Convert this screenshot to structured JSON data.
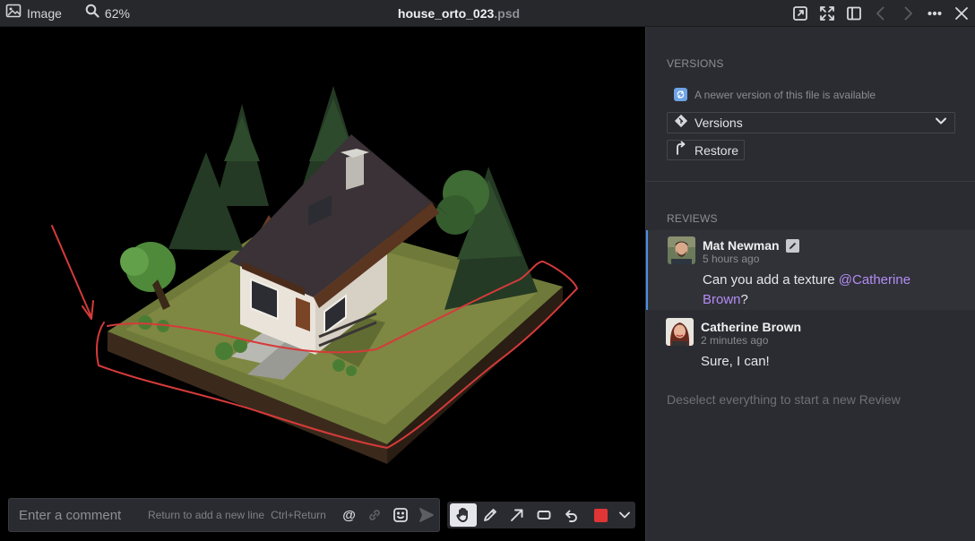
{
  "topbar": {
    "image_label": "Image",
    "zoom": "62%",
    "filename_base": "house_orto_023",
    "filename_ext": ".psd",
    "icons": [
      "image-icon",
      "zoom-icon",
      "open-external-icon",
      "fullscreen-icon",
      "panel-toggle-icon",
      "prev-icon",
      "next-icon",
      "more-icon",
      "close-icon"
    ]
  },
  "comment": {
    "placeholder": "Enter a comment",
    "hint_newline": "Return to add a new line",
    "hint_send": "Ctrl+Return to send",
    "mention_symbol": "@"
  },
  "tools": {
    "items": [
      "hand-tool",
      "pen-tool",
      "arrow-tool",
      "rectangle-tool",
      "undo-tool"
    ],
    "active": "hand-tool",
    "color": "#e03535"
  },
  "panel": {
    "versions_title": "VERSIONS",
    "newer_notice": "A newer version of this file is available",
    "versions_select": "Versions",
    "restore_label": "Restore",
    "reviews_title": "REVIEWS",
    "reviews": [
      {
        "author": "Mat Newman",
        "time": "5 hours ago",
        "text_before": "Can you add a texture ",
        "mention_a": "@Catherine",
        "mention_b": "Brown",
        "text_after": "?"
      },
      {
        "author": "Catherine Brown",
        "time": "2 minutes ago",
        "text": "Sure, I can!"
      }
    ],
    "empty_hint": "Deselect everything to start a new Review"
  },
  "colors": {
    "accent": "#4a90e2",
    "mention": "#b48cf5",
    "annotation": "#d63a3a",
    "panel_bg": "#2b2c31"
  }
}
